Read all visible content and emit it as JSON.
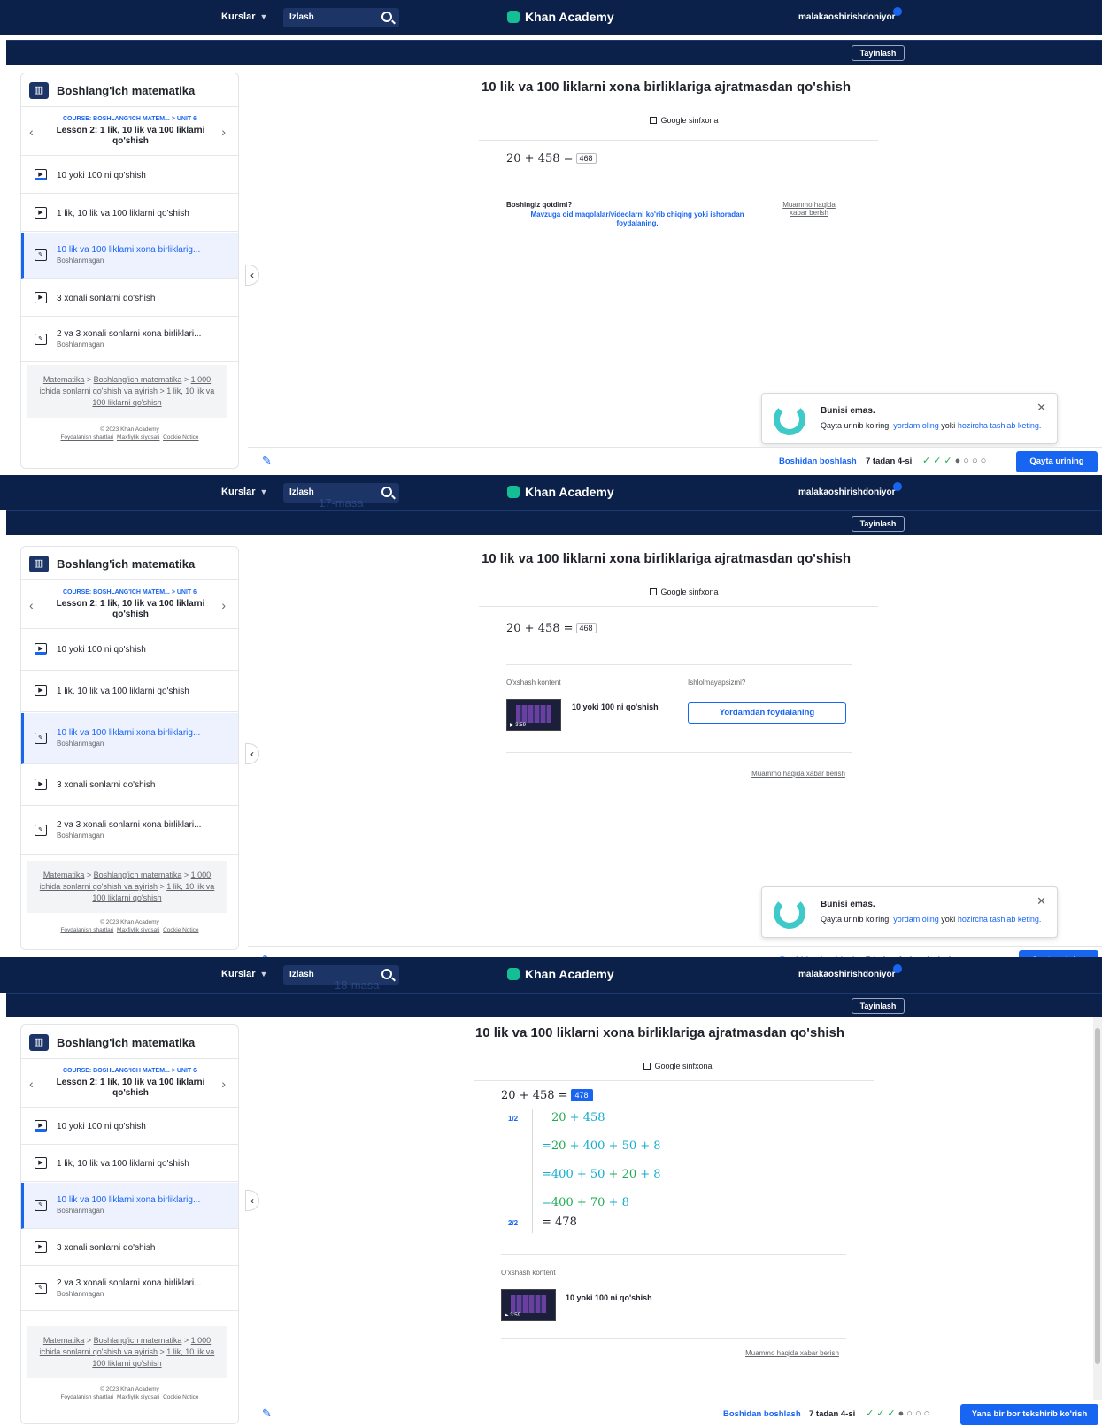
{
  "topbar": {
    "courses_label": "Kurslar",
    "search_placeholder": "Izlash",
    "logo": "Khan Academy",
    "username": "malakaoshirishdoniyor",
    "assign_label": "Tayinlash"
  },
  "ghost_overlays": [
    "17-masa",
    "18-masa"
  ],
  "sidebar": {
    "title": "Boshlang'ich matematika",
    "course": "COURSE: BOSHLANG'ICH MATEM... > UNIT 6",
    "lesson": "Lesson 2: 1 lik, 10 lik va 100 liklarni qo'shish",
    "items": [
      {
        "label": "10 yoki 100 ni qo'shish",
        "sub": ""
      },
      {
        "label": "1 lik, 10 lik va 100 liklarni qo'shish",
        "sub": ""
      },
      {
        "label": "10 lik va 100 liklarni xona birliklarig...",
        "sub": "Boshlanmagan"
      },
      {
        "label": "3 xonali sonlarni qo'shish",
        "sub": ""
      },
      {
        "label": "2 va 3 xonali sonlarni xona birliklari...",
        "sub": "Boshlanmagan"
      }
    ],
    "breadcrumb": {
      "p1": "Matematika",
      "p2": "Boshlang'ich matematika",
      "p3": "1 000 ichida sonlarni qo'shish va ayirish",
      "p4": "1 lik, 10 lik va 100 liklarni qo'shish"
    },
    "copyright": "© 2023 Khan Academy",
    "links": [
      "Foydalanish shartlari",
      "Maxfiylik siyosati",
      "Cookie Notice"
    ]
  },
  "exercise": {
    "title": "10 lik va 100 liklarni xona birliklariga ajratmasdan qo'shish",
    "classroom": "Google sinfxona",
    "equation": "20 + 458 =",
    "answer1": "468",
    "answer3": "478"
  },
  "frame1": {
    "stuck": "Boshingiz qotdimi?",
    "stuck_help": "Mavzuga oid maqolalar/videolarni ko'rib chiqing yoki ishoradan foydalaning.",
    "report": "Muammo haqida xabar berish"
  },
  "frame2": {
    "related": "O'xshash kontent",
    "not_working": "Ishlolmayapsizmi?",
    "video_title": "10 yoki 100 ni qo'shish",
    "video_time": "3:59",
    "help_button": "Yordamdan foydalaning",
    "report": "Muammo haqida xabar berish"
  },
  "frame3": {
    "hint1_num": "1/2",
    "hint2_num": "2/2",
    "steps": {
      "s1a": "20",
      "s1b": " + 458",
      "s2a": "=",
      "s2b": "20",
      "s2c": " + 400 + 50 + 8",
      "s3a": "=",
      "s3b": "400 + 50",
      "s3c": " + 20",
      "s3d": " + 8",
      "s4a": "=",
      "s4b": "400 + 70",
      "s4c": " + 8",
      "s5": "= 478"
    },
    "related": "O'xshash kontent",
    "video_title": "10 yoki 100 ni qo'shish",
    "video_time": "3:59",
    "report": "Muammo haqida xabar berish"
  },
  "toast": {
    "title": "Bunisi emas.",
    "msg_a": "Qayta urinib ko'ring, ",
    "msg_link1": "yordam oling",
    "msg_b": " yoki ",
    "msg_link2": "hozircha tashlab keting."
  },
  "bottom": {
    "restart": "Boshidan boshlash",
    "progress": "7 tadan 4-si",
    "retry": "Qayta urining",
    "check_again": "Yana bir bor tekshirib ko'rish"
  },
  "colors": {
    "nav": "#0b2149",
    "accent": "#1865f2",
    "green": "#1fab54",
    "teal": "#11accd"
  }
}
